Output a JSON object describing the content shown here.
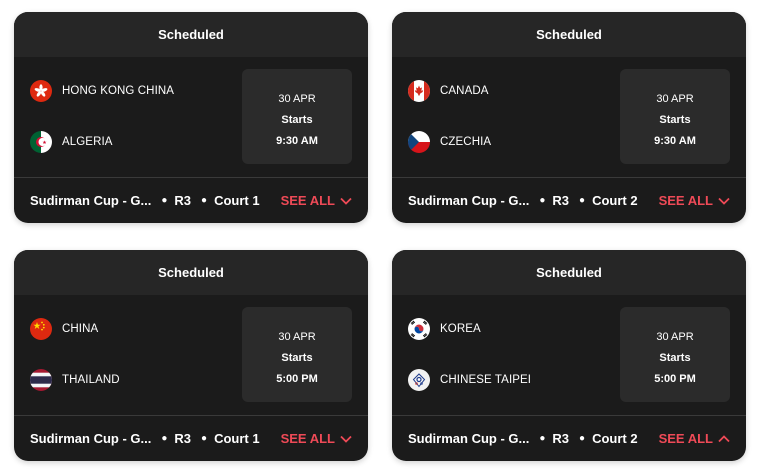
{
  "accent_color": "#ef4a57",
  "matches": [
    {
      "status": "Scheduled",
      "team1": {
        "name": "HONG KONG CHINA",
        "flag": "hong-kong-flag-icon"
      },
      "team2": {
        "name": "ALGERIA",
        "flag": "algeria-flag-icon"
      },
      "date": "30 APR",
      "starts_label": "Starts",
      "time": "9:30 AM",
      "event": "Sudirman Cup - G...",
      "round": "R3",
      "court": "Court 1",
      "see_all": "SEE ALL",
      "chevron": "chevron-down-icon"
    },
    {
      "status": "Scheduled",
      "team1": {
        "name": "CANADA",
        "flag": "canada-flag-icon"
      },
      "team2": {
        "name": "CZECHIA",
        "flag": "czechia-flag-icon"
      },
      "date": "30 APR",
      "starts_label": "Starts",
      "time": "9:30 AM",
      "event": "Sudirman Cup - G...",
      "round": "R3",
      "court": "Court 2",
      "see_all": "SEE ALL",
      "chevron": "chevron-down-icon"
    },
    {
      "status": "Scheduled",
      "team1": {
        "name": "CHINA",
        "flag": "china-flag-icon"
      },
      "team2": {
        "name": "THAILAND",
        "flag": "thailand-flag-icon"
      },
      "date": "30 APR",
      "starts_label": "Starts",
      "time": "5:00 PM",
      "event": "Sudirman Cup - G...",
      "round": "R3",
      "court": "Court 1",
      "see_all": "SEE ALL",
      "chevron": "chevron-down-icon"
    },
    {
      "status": "Scheduled",
      "team1": {
        "name": "KOREA",
        "flag": "korea-flag-icon"
      },
      "team2": {
        "name": "CHINESE TAIPEI",
        "flag": "chinese-taipei-flag-icon"
      },
      "date": "30 APR",
      "starts_label": "Starts",
      "time": "5:00 PM",
      "event": "Sudirman Cup - G...",
      "round": "R3",
      "court": "Court 2",
      "see_all": "SEE ALL",
      "chevron": "chevron-up-icon"
    }
  ]
}
